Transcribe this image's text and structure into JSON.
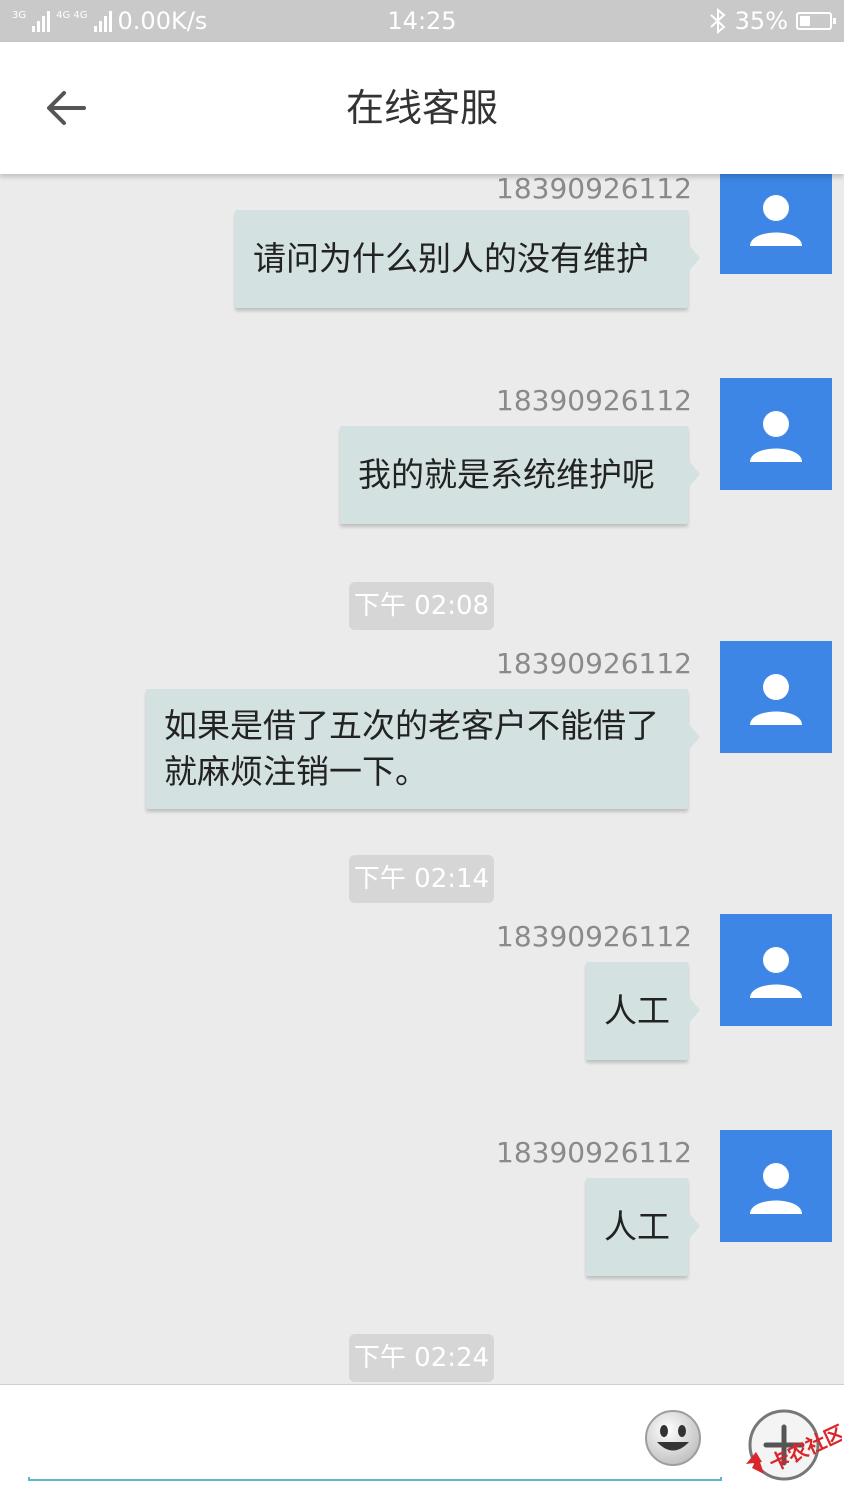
{
  "status_bar": {
    "network_a": "3G",
    "network_b": "4G 4G",
    "speed": "0.00K/s",
    "time": "14:25",
    "battery": "35%",
    "battery_level": 0.35
  },
  "header": {
    "title": "在线客服",
    "back_icon": "arrow-left-icon"
  },
  "colors": {
    "bubble": "#d3e2e1",
    "avatar": "#3d86e6",
    "input_underline": "#5ab8c8",
    "background": "#ebebeb"
  },
  "messages": [
    {
      "sender": "18390926112",
      "text": "请问为什么别人的没有维护"
    },
    {
      "sender": "18390926112",
      "text": "我的就是系统维护呢"
    },
    {
      "timestamp": "下午 02:08"
    },
    {
      "sender": "18390926112",
      "text": "如果是借了五次的老客户不能借了就麻烦注销一下。"
    },
    {
      "timestamp": "下午 02:14"
    },
    {
      "sender": "18390926112",
      "text": "人工"
    },
    {
      "sender": "18390926112",
      "text": "人工"
    },
    {
      "timestamp": "下午 02:24"
    }
  ],
  "input": {
    "placeholder": "",
    "emoji_icon": "smiley-icon",
    "plus_icon": "plus-icon"
  },
  "watermark": {
    "text": "卡农社区"
  }
}
